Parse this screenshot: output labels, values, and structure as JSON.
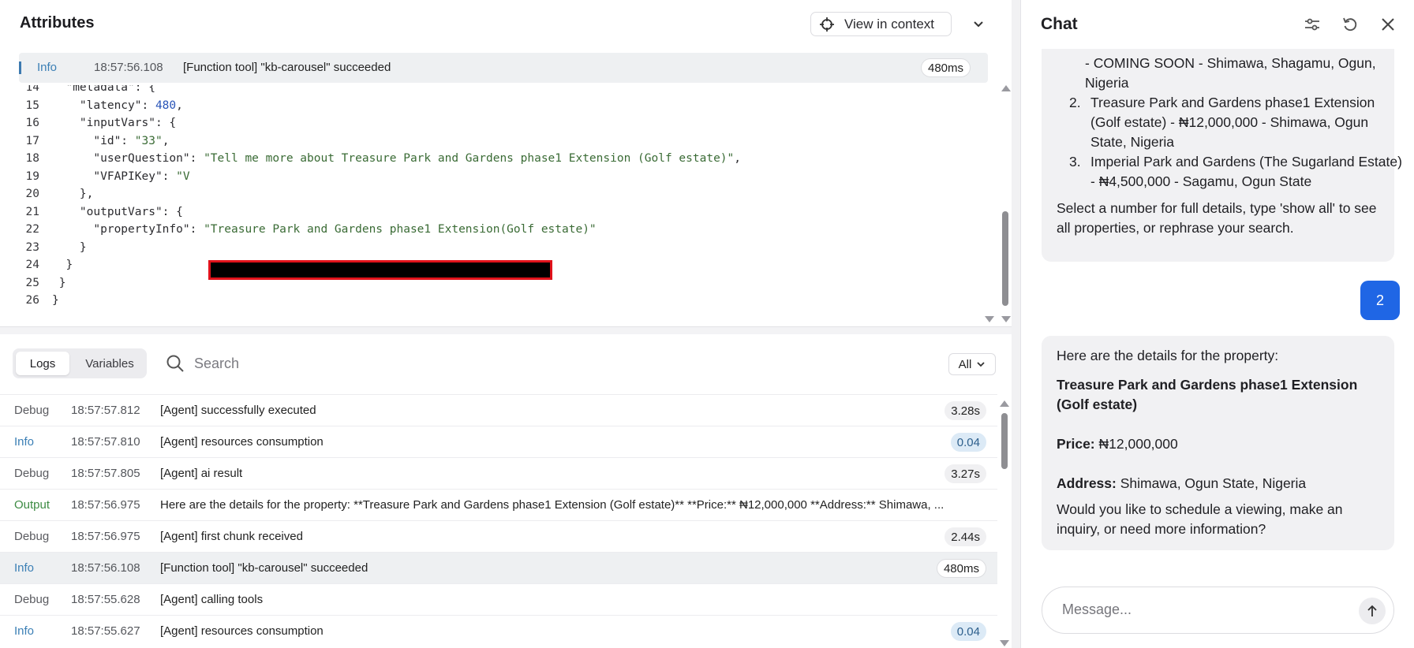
{
  "attributes": {
    "title": "Attributes",
    "view_in_context": "View in context",
    "selected": {
      "level": "Info",
      "time": "18:57:56.108",
      "message": "[Function tool] \"kb-carousel\" succeeded",
      "duration": "480ms"
    }
  },
  "code": {
    "lines": [
      {
        "n": "14",
        "t": "  \"metadata\": {"
      },
      {
        "n": "15",
        "t": "    \"latency\": 480,"
      },
      {
        "n": "16",
        "t": "    \"inputVars\": {"
      },
      {
        "n": "17",
        "t": "      \"id\": \"33\","
      },
      {
        "n": "18",
        "t": "      \"userQuestion\": \"Tell me more about Treasure Park and Gardens phase1 Extension (Golf estate)\","
      },
      {
        "n": "19",
        "t": "      \"VFAPIKey\": \"V"
      },
      {
        "n": "20",
        "t": "    },"
      },
      {
        "n": "21",
        "t": "    \"outputVars\": {"
      },
      {
        "n": "22",
        "t": "      \"propertyInfo\": \"Treasure Park and Gardens phase1 Extension(Golf estate)\""
      },
      {
        "n": "23",
        "t": "    }"
      },
      {
        "n": "24",
        "t": "  }"
      },
      {
        "n": "25",
        "t": " }"
      },
      {
        "n": "26",
        "t": "}"
      }
    ]
  },
  "logs": {
    "tab_logs": "Logs",
    "tab_variables": "Variables",
    "search_placeholder": "Search",
    "filter": "All",
    "rows": [
      {
        "level": "Debug",
        "time": "18:57:57.812",
        "message": "[Agent] successfully executed",
        "duration": "3.28s",
        "pill": "gray"
      },
      {
        "level": "Info",
        "time": "18:57:57.810",
        "message": "[Agent] resources consumption",
        "duration": "0.04",
        "pill": "blue"
      },
      {
        "level": "Debug",
        "time": "18:57:57.805",
        "message": "[Agent] ai result",
        "duration": "3.27s",
        "pill": "gray"
      },
      {
        "level": "Output",
        "time": "18:57:56.975",
        "message": "Here are the details for the property: **Treasure Park and Gardens phase1 Extension (Golf estate)** **Price:** ₦12,000,000 **Address:** Shimawa, ...",
        "duration": "",
        "pill": ""
      },
      {
        "level": "Debug",
        "time": "18:57:56.975",
        "message": "[Agent] first chunk received",
        "duration": "2.44s",
        "pill": "gray"
      },
      {
        "level": "Info",
        "time": "18:57:56.108",
        "message": "[Function tool] \"kb-carousel\" succeeded",
        "duration": "480ms",
        "pill": "white"
      },
      {
        "level": "Debug",
        "time": "18:57:55.628",
        "message": "[Agent] calling tools",
        "duration": "",
        "pill": ""
      },
      {
        "level": "Info",
        "time": "18:57:55.627",
        "message": "[Agent] resources consumption",
        "duration": "0.04",
        "pill": "blue"
      }
    ]
  },
  "chat": {
    "title": "Chat",
    "list": [
      {
        "n": "",
        "text": "- COMING SOON - Shimawa, Shagamu, Ogun, Nigeria"
      },
      {
        "n": "2.",
        "text": "Treasure Park and Gardens phase1 Extension (Golf estate) - ₦12,000,000 - Shimawa, Ogun State, Nigeria"
      },
      {
        "n": "3.",
        "text": "Imperial Park and Gardens (The Sugarland Estate) - ₦4,500,000 - Sagamu, Ogun State"
      }
    ],
    "prompt": "Select a number for full details, type 'show all' to see all properties, or rephrase your search.",
    "user_message": "2",
    "reply_intro": "Here are the details for the property:",
    "reply_name": "Treasure Park and Gardens phase1 Extension (Golf estate)",
    "price_label": "Price:",
    "price_value": "₦12,000,000",
    "address_label": "Address:",
    "address_value": "Shimawa, Ogun State, Nigeria",
    "reply_followup": "Would you like to schedule a viewing, make an inquiry, or need more information?",
    "composer_placeholder": "Message..."
  }
}
